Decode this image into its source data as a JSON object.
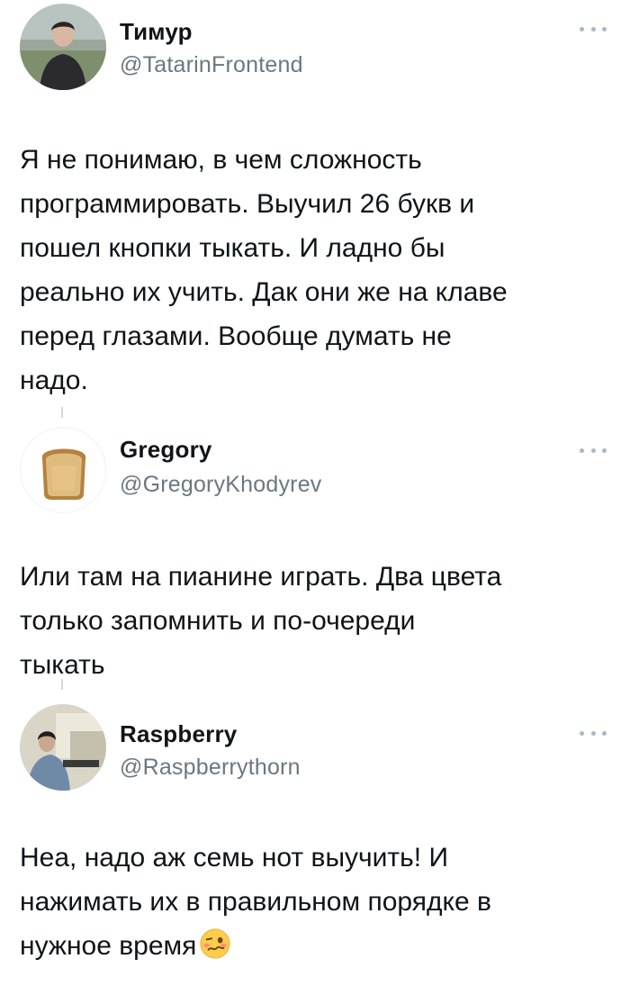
{
  "tweets": [
    {
      "author": {
        "name": "Тимур",
        "handle": "@TatarinFrontend",
        "avatar_icon": "user-avatar-photo"
      },
      "text": "Я не понимаю, в чем сложность\nпрограммировать. Выучил 26 букв и\nпошел кнопки тыкать. И ладно бы\nреально их учить. Дак они же на клаве\nперед глазами. Вообще думать не\nнадо.",
      "more_icon": "more-options-icon"
    },
    {
      "author": {
        "name": "Gregory",
        "handle": "@GregoryKhodyrev",
        "avatar_icon": "toast-bread-avatar"
      },
      "text": "Или там на пианине играть. Два цвета\nтолько запомнить и по-очереди\nтыкать",
      "more_icon": "more-options-icon"
    },
    {
      "author": {
        "name": "Raspberry",
        "handle": "@Raspberrythorn",
        "avatar_icon": "painting-avatar"
      },
      "text": "Неа, надо аж семь нот выучить! И\nнажимать их в правильном порядке в\nнужное время",
      "emoji": "woozy-face-emoji",
      "more_icon": "more-options-icon"
    }
  ],
  "colors": {
    "text_primary": "#0f1419",
    "text_secondary": "#6b7780",
    "thread_line": "#cfd9de",
    "more_dots": "#aab8c2"
  }
}
